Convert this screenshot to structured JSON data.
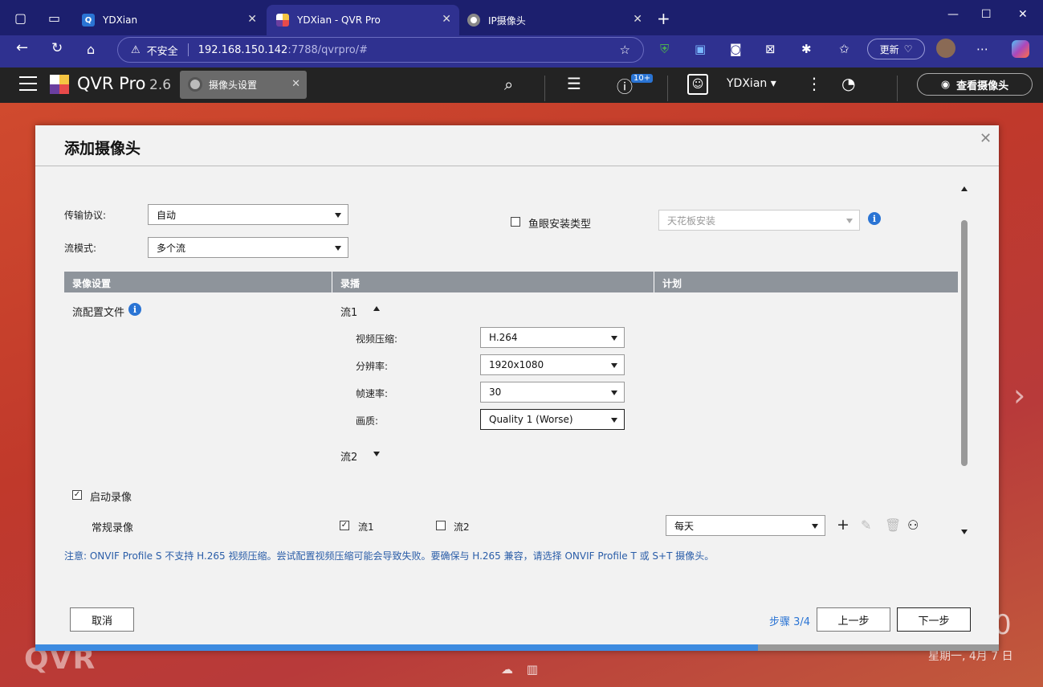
{
  "browser": {
    "tabs": [
      {
        "title": "YDXian",
        "active": false
      },
      {
        "title": "YDXian - QVR Pro",
        "active": true
      },
      {
        "title": "IP摄像头",
        "active": false
      }
    ],
    "new_tab": "+",
    "url_warning": "不安全",
    "url_host": "192.168.150.142",
    "url_path": ":7788/qvrpro/#",
    "update_label": "更新"
  },
  "app": {
    "title": "QVR Pro",
    "version": "2.6",
    "open_tab": "摄像头设置",
    "notification_badge": "10+",
    "user": "YDXian",
    "view_cameras": "查看摄像头"
  },
  "background": {
    "brand": "QVR",
    "date": "星期一, 4月 7 日",
    "time_fragment": "0"
  },
  "dialog": {
    "title": "添加摄像头",
    "protocol_label": "传输协议:",
    "protocol_value": "自动",
    "stream_mode_label": "流模式:",
    "stream_mode_value": "多个流",
    "fisheye_label": "鱼眼安装类型",
    "fisheye_checked": false,
    "fisheye_value": "天花板安装",
    "table_headers": [
      "录像设置",
      "录播",
      "计划"
    ],
    "profile_label": "流配置文件",
    "stream1_label": "流1",
    "stream2_label": "流2",
    "video_codec_label": "视频压缩:",
    "video_codec_value": "H.264",
    "resolution_label": "分辨率:",
    "resolution_value": "1920x1080",
    "fps_label": "帧速率:",
    "fps_value": "30",
    "quality_label": "画质:",
    "quality_value": "Quality 1 (Worse)",
    "enable_recording_label": "启动录像",
    "enable_recording_checked": true,
    "regular_recording_label": "常规录像",
    "rec_stream1_label": "流1",
    "rec_stream1_checked": true,
    "rec_stream2_label": "流2",
    "rec_stream2_checked": false,
    "schedule_value": "每天",
    "note": "注意: ONVIF Profile S 不支持 H.265 视频压缩。尝试配置视频压缩可能会导致失败。要确保与 H.265 兼容，请选择 ONVIF Profile T 或 S+T 摄像头。",
    "cancel_label": "取消",
    "step_label": "步骤 3/4",
    "prev_label": "上一步",
    "next_label": "下一步",
    "progress": 0.75
  },
  "colors": {
    "tabbar": "#1c1f6e",
    "addrbar": "#2f3190",
    "app_header": "#232323",
    "accent": "#2a74d4",
    "table_header": "#8e949b"
  }
}
